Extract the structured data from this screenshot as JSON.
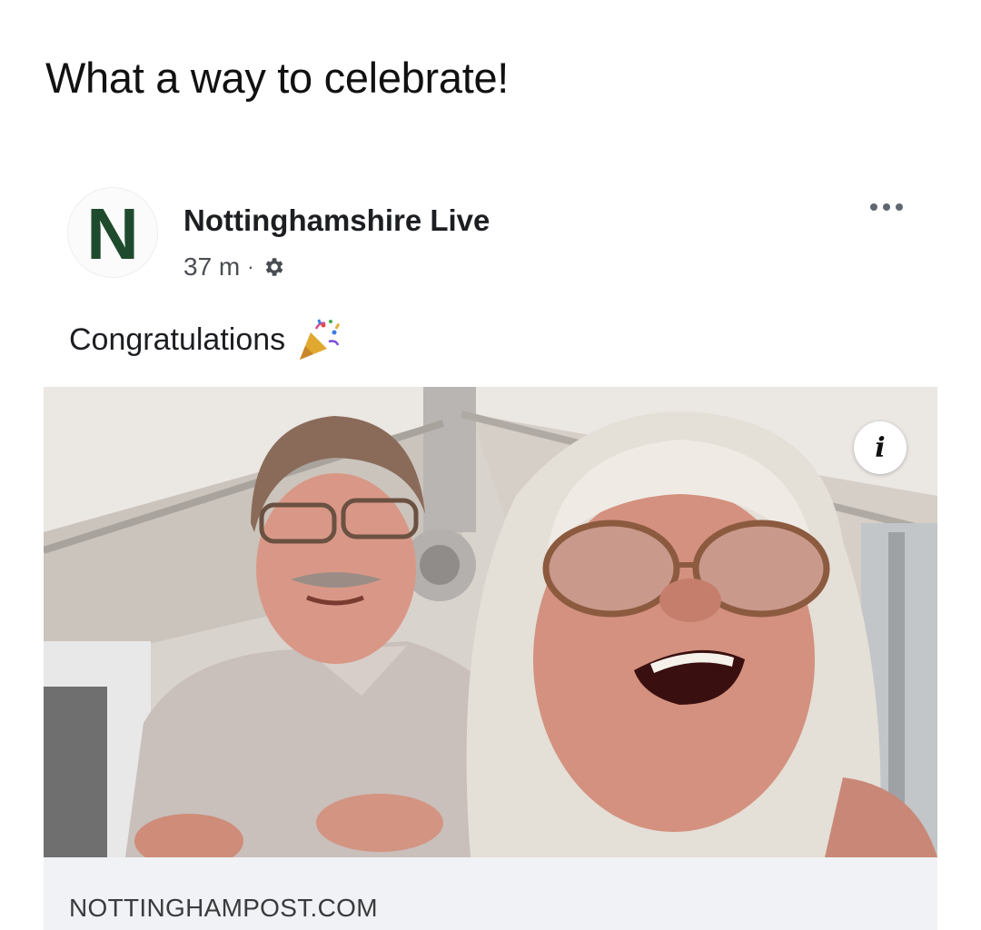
{
  "caption": "What a way to celebrate!",
  "post": {
    "page_name": "Nottinghamshire Live",
    "avatar_letter": "N",
    "time": "37 m",
    "separator": "·",
    "audience_icon": "settings-gear-icon",
    "more_icon": "more-options-icon",
    "text": "Congratulations",
    "emoji_icon": "party-popper-icon"
  },
  "media": {
    "image_description_icon": "info-icon",
    "info_label": "i"
  },
  "link": {
    "domain": "NOTTINGHAMPOST.COM"
  },
  "colors": {
    "avatar_letter": "#1e4b2d",
    "link_bar_bg": "#f0f2f5",
    "text_primary": "#1c1e21"
  }
}
